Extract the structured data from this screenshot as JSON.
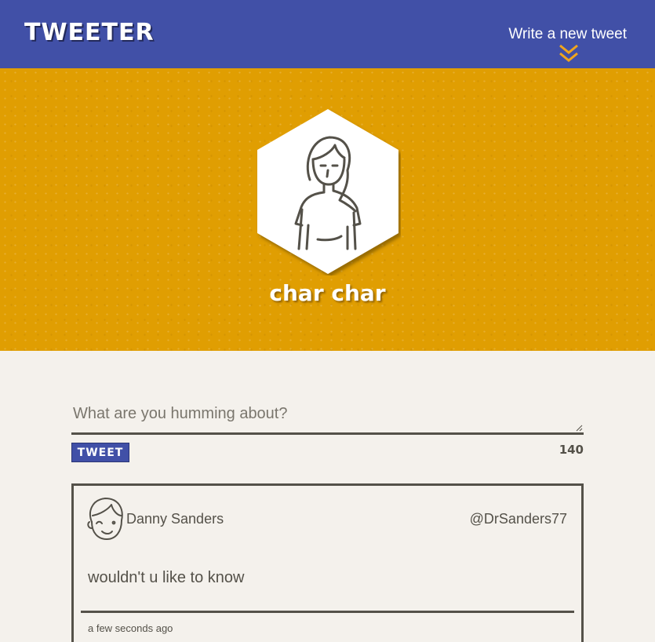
{
  "nav": {
    "brand": "TWEETER",
    "compose_label": "Write a new tweet",
    "compose_icon": "double-chevron-down-icon"
  },
  "profile": {
    "name": "char char",
    "avatar_icon": "female-avatar-icon"
  },
  "composer": {
    "placeholder": "What are you humming about?",
    "value": "",
    "submit_label": "TWEET",
    "char_count": "140"
  },
  "tweets": [
    {
      "author_name": "Danny Sanders",
      "handle": "@DrSanders77",
      "content": "wouldn't u like to know",
      "timestamp": "a few seconds ago",
      "avatar_icon": "male-avatar-icon"
    }
  ],
  "colors": {
    "nav_bg": "#4150a7",
    "profile_bg": "#e09e02",
    "page_bg": "#f4f1ec",
    "text": "#545149",
    "accent_arrow": "#f0a51c"
  }
}
